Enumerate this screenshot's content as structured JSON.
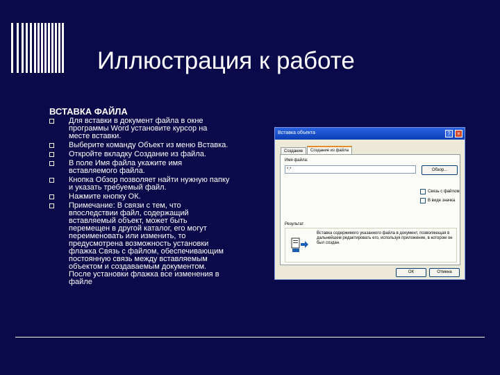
{
  "slide": {
    "title": "Иллюстрация к работе",
    "section": "ВСТАВКА ФАЙЛА",
    "bullets": [
      "Для вставки в документ файла в окне программы Word установите курсор на месте вставки.",
      "Выберите команду Объект из меню Вставка.",
      "Откройте вкладку Создание из файла.",
      "В поле Имя файла укажите имя вставляемого файла.",
      "Кнопка Обзор позволяет найти нужную папку и указать требуемый файл.",
      "Нажмите кнопку ОК.",
      "Примечание: В связи с тем, что впоследствии файл, содержащий вставляемый объект, может быть перемещен в другой каталог, его могут переименовать или изменить, то предусмотрена возможность установки флажка Связь с файлом, обеспечивающим постоянную связь между вставляемым объектом и создаваемым документом. После установки флажка все изменения в файле"
    ]
  },
  "dialog": {
    "title": "Вставка объекта",
    "help_label": "?",
    "close_label": "×",
    "tabs": [
      "Создание",
      "Создание из файла"
    ],
    "filename_label": "Имя файла:",
    "filename_value": "*.*",
    "browse_label": "Обзор...",
    "link_label": "Связь с файлом",
    "icon_label": "В виде значка",
    "result_label": "Результат",
    "result_text": "Вставка содержимого указанного файла в документ, позволяющая в дальнейшем редактировать его, используя приложение, в котором он был создан.",
    "ok_label": "ОК",
    "cancel_label": "Отмена"
  },
  "colors": {
    "background": "#0a0a4a",
    "text": "#ffffff",
    "dialog_face": "#ece9d8",
    "titlebar": "#0a3fb8"
  }
}
